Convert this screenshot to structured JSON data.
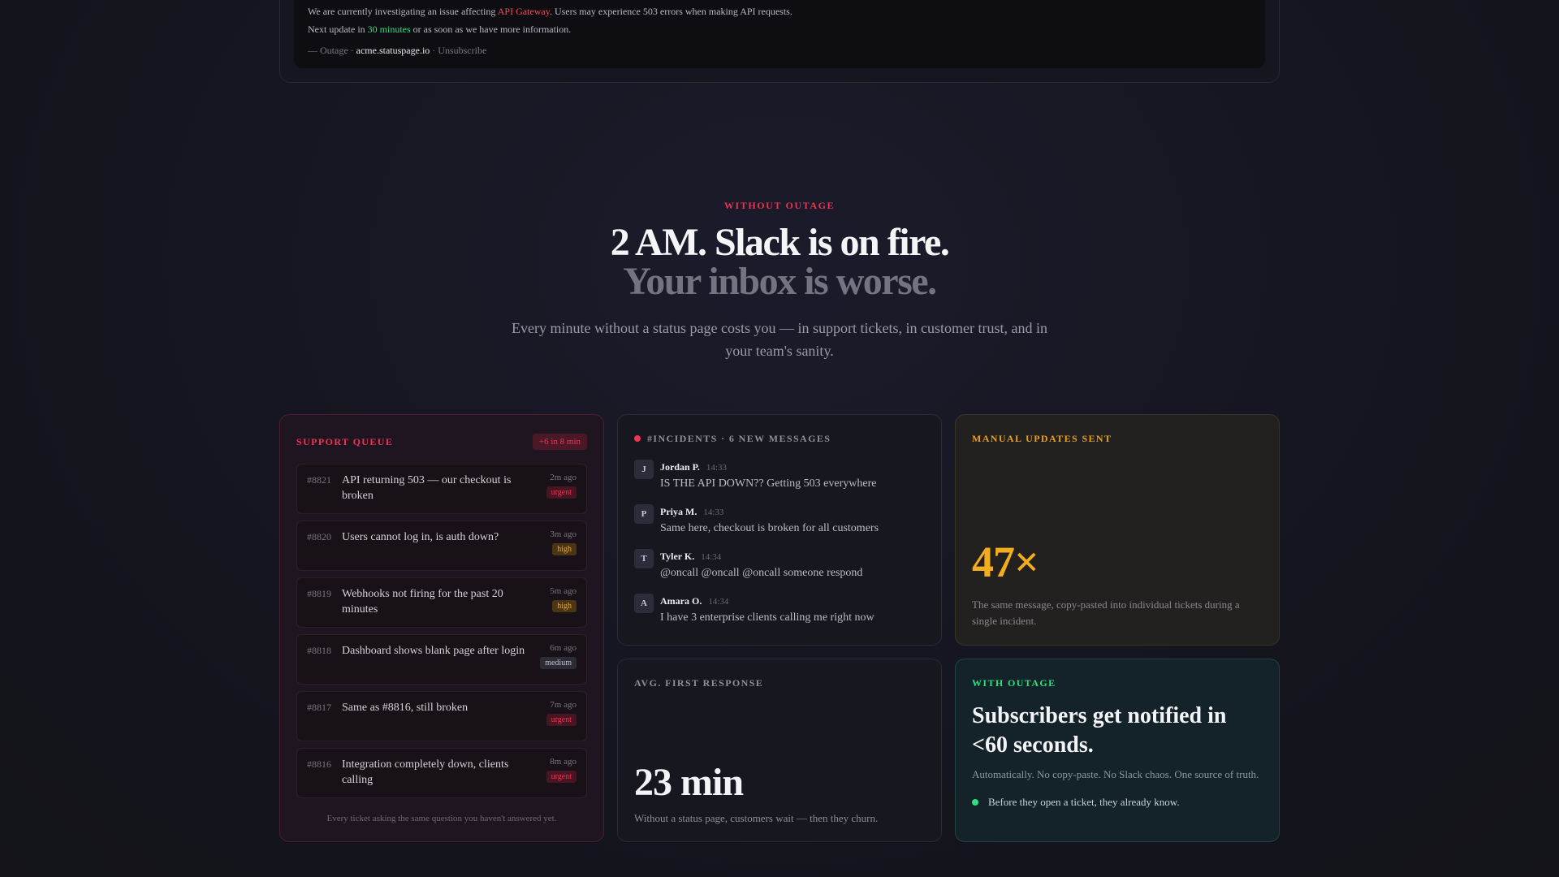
{
  "email": {
    "line1_pre": "We are currently investigating an issue affecting ",
    "line1_highlight": "API Gateway",
    "line1_post": ". Users may experience 503 errors when making API requests.",
    "line2_pre": "Next update in ",
    "line2_highlight": "30 minutes",
    "line2_post": " or as soon as we have more information.",
    "footer_pre": "— Outage · ",
    "footer_domain": "acme.statuspage.io",
    "footer_sep": " · ",
    "footer_unsubscribe": "Unsubscribe"
  },
  "hero": {
    "eyebrow": "WITHOUT OUTAGE",
    "headline_1": "2 AM. Slack is on fire.",
    "headline_2": "Your inbox is worse.",
    "subtitle": "Every minute without a status page costs you — in support tickets, in customer trust, and in your team's sanity."
  },
  "queue": {
    "label": "SUPPORT QUEUE",
    "count": "+6 in 8 min",
    "tickets": [
      {
        "id": "#8821",
        "title": "API returning 503 — our checkout is broken",
        "ago": "2m ago",
        "priority": "urgent"
      },
      {
        "id": "#8820",
        "title": "Users cannot log in, is auth down?",
        "ago": "3m ago",
        "priority": "high"
      },
      {
        "id": "#8819",
        "title": "Webhooks not firing for the past 20 minutes",
        "ago": "5m ago",
        "priority": "high"
      },
      {
        "id": "#8818",
        "title": "Dashboard shows blank page after login",
        "ago": "6m ago",
        "priority": "medium"
      },
      {
        "id": "#8817",
        "title": "Same as #8816, still broken",
        "ago": "7m ago",
        "priority": "urgent"
      },
      {
        "id": "#8816",
        "title": "Integration completely down, clients calling",
        "ago": "8m ago",
        "priority": "urgent"
      }
    ],
    "footer": "Every ticket asking the same question you haven't answered yet."
  },
  "incidents": {
    "label": "#INCIDENTS · 6 NEW MESSAGES",
    "messages": [
      {
        "initial": "J",
        "name": "Jordan P.",
        "time": "14:33",
        "text": "IS THE API DOWN?? Getting 503 everywhere"
      },
      {
        "initial": "P",
        "name": "Priya M.",
        "time": "14:33",
        "text": "Same here, checkout is broken for all customers"
      },
      {
        "initial": "T",
        "name": "Tyler K.",
        "time": "14:34",
        "text": "@oncall @oncall @oncall someone respond"
      },
      {
        "initial": "A",
        "name": "Amara O.",
        "time": "14:34",
        "text": "I have 3 enterprise clients calling me right now"
      }
    ]
  },
  "manual": {
    "label": "MANUAL UPDATES SENT",
    "value": "47×",
    "desc": "The same message, copy-pasted into individual tickets during a single incident."
  },
  "response": {
    "label": "AVG. FIRST RESPONSE",
    "value": "23 min",
    "desc": "Without a status page, customers wait — then they churn."
  },
  "with_outage": {
    "label": "WITH OUTAGE",
    "title": "Subscribers get notified in <60 seconds.",
    "desc": "Automatically. No copy-paste. No Slack chaos. One source of truth.",
    "point": "Before they open a ticket, they already know."
  },
  "colors": {
    "accent_red": "#ef3454",
    "accent_green": "#2ee07f",
    "accent_amber": "#f2ad1e",
    "background": "#15151f"
  }
}
